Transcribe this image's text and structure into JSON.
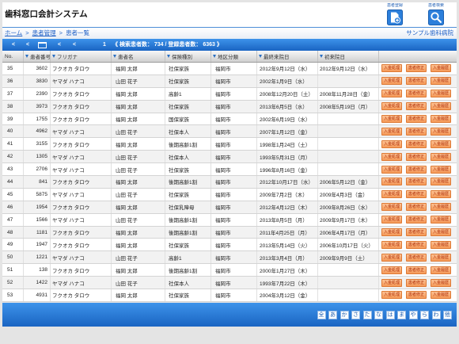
{
  "app": {
    "title": "歯科窓口会計システム"
  },
  "header_actions": {
    "register": {
      "label": "患者登録",
      "icon": "patient-register-icon"
    },
    "search": {
      "label": "患者検索",
      "icon": "patient-search-icon"
    }
  },
  "breadcrumb": {
    "items": [
      "ホーム",
      "患者管理",
      "患者一覧"
    ],
    "separator": ">"
  },
  "clinic_name": "サンプル歯科病院",
  "pager": {
    "nav": [
      "<",
      "<",
      "<",
      "<"
    ],
    "calendar_icon": "calendar-icon",
    "page": "1",
    "summary": "《 検索患者数： 734 / 登録患者数： 6363 》"
  },
  "table": {
    "columns": [
      "No.",
      "患者番号",
      "フリガナ",
      "患者名",
      "保険種別",
      "地区分類",
      "最終来院日",
      "初来院日"
    ],
    "sort_icon": "sort-icon",
    "row_actions": [
      "入金処理",
      "患者修正",
      "入金履歴"
    ],
    "rows": [
      {
        "no": "35",
        "patient_id": "3602",
        "kana": "フクオカ タロウ",
        "name": "福岡 太郎",
        "insurance": "社保家族",
        "district": "福岡市",
        "last_visit": "2012年9月12日（水）",
        "first_visit": "2012年9月12日（水）"
      },
      {
        "no": "36",
        "patient_id": "3830",
        "kana": "ヤマダ ハナコ",
        "name": "山田 花子",
        "insurance": "社保家族",
        "district": "福岡市",
        "last_visit": "2002年1月9日（水）",
        "first_visit": ""
      },
      {
        "no": "37",
        "patient_id": "2390",
        "kana": "フクオカ タロウ",
        "name": "福岡 太郎",
        "insurance": "高齢1",
        "district": "福岡市",
        "last_visit": "2008年12月20日（土）",
        "first_visit": "2008年11月28日（金）"
      },
      {
        "no": "38",
        "patient_id": "3973",
        "kana": "フクオカ タロウ",
        "name": "福岡 太郎",
        "insurance": "社保家族",
        "district": "福岡市",
        "last_visit": "2013年6月5日（水）",
        "first_visit": "2008年5月19日（月）"
      },
      {
        "no": "39",
        "patient_id": "1755",
        "kana": "フクオカ タロウ",
        "name": "福岡 太郎",
        "insurance": "国保家族",
        "district": "福岡市",
        "last_visit": "2002年6月19日（水）",
        "first_visit": ""
      },
      {
        "no": "40",
        "patient_id": "4962",
        "kana": "ヤマダ ハナコ",
        "name": "山田 花子",
        "insurance": "社保本人",
        "district": "福岡市",
        "last_visit": "2007年1月12日（金）",
        "first_visit": ""
      },
      {
        "no": "41",
        "patient_id": "3155",
        "kana": "フクオカ タロウ",
        "name": "福岡 太郎",
        "insurance": "後期高齢1割",
        "district": "福岡市",
        "last_visit": "1998年1月24日（土）",
        "first_visit": ""
      },
      {
        "no": "42",
        "patient_id": "1305",
        "kana": "ヤマダ ハナコ",
        "name": "山田 花子",
        "insurance": "社保本人",
        "district": "福岡市",
        "last_visit": "1993年5月31日（月）",
        "first_visit": ""
      },
      {
        "no": "43",
        "patient_id": "2706",
        "kana": "ヤマダ ハナコ",
        "name": "山田 花子",
        "insurance": "社保家族",
        "district": "福岡市",
        "last_visit": "1996年8月16日（金）",
        "first_visit": ""
      },
      {
        "no": "44",
        "patient_id": "841",
        "kana": "フクオカ タロウ",
        "name": "福岡 太郎",
        "insurance": "後期高齢1割",
        "district": "福岡市",
        "last_visit": "2012年10月17日（水）",
        "first_visit": "2006年5月12日（金）"
      },
      {
        "no": "45",
        "patient_id": "5875",
        "kana": "ヤマダ ハナコ",
        "name": "山田 花子",
        "insurance": "社保家族",
        "district": "福岡市",
        "last_visit": "2009年7月2日（木）",
        "first_visit": "2009年4月3日（金）"
      },
      {
        "no": "46",
        "patient_id": "1954",
        "kana": "フクオカ タロウ",
        "name": "福岡 太郎",
        "insurance": "社保乳障母",
        "district": "福岡市",
        "last_visit": "2012年4月12日（木）",
        "first_visit": "2009年8月26日（水）"
      },
      {
        "no": "47",
        "patient_id": "1566",
        "kana": "ヤマダ ハナコ",
        "name": "山田 花子",
        "insurance": "後期高齢1割",
        "district": "福岡市",
        "last_visit": "2013年8月5日（月）",
        "first_visit": "2009年9月17日（木）"
      },
      {
        "no": "48",
        "patient_id": "1181",
        "kana": "フクオカ タロウ",
        "name": "福岡 太郎",
        "insurance": "後期高齢1割",
        "district": "福岡市",
        "last_visit": "2011年4月25日（月）",
        "first_visit": "2006年4月17日（月）"
      },
      {
        "no": "49",
        "patient_id": "1947",
        "kana": "フクオカ タロウ",
        "name": "福岡 太郎",
        "insurance": "社保家族",
        "district": "福岡市",
        "last_visit": "2013年5月14日（火）",
        "first_visit": "2006年10月17日（火）"
      },
      {
        "no": "50",
        "patient_id": "1221",
        "kana": "ヤマダ ハナコ",
        "name": "山田 花子",
        "insurance": "高齢1",
        "district": "福岡市",
        "last_visit": "2013年3月4日（月）",
        "first_visit": "2009年9月9日（土）"
      },
      {
        "no": "51",
        "patient_id": "138",
        "kana": "フクオカ タロウ",
        "name": "福岡 太郎",
        "insurance": "後期高齢1割",
        "district": "福岡市",
        "last_visit": "2000年1月27日（木）",
        "first_visit": ""
      },
      {
        "no": "52",
        "patient_id": "1422",
        "kana": "ヤマダ ハナコ",
        "name": "山田 花子",
        "insurance": "社保本人",
        "district": "福岡市",
        "last_visit": "1993年7月22日（木）",
        "first_visit": ""
      },
      {
        "no": "53",
        "patient_id": "4931",
        "kana": "フクオカ タロウ",
        "name": "福岡 太郎",
        "insurance": "社保家族",
        "district": "福岡市",
        "last_visit": "2004年3月12日（金）",
        "first_visit": ""
      }
    ]
  },
  "kana_index": [
    "全",
    "あ",
    "か",
    "さ",
    "た",
    "な",
    "は",
    "ま",
    "や",
    "ら",
    "わ",
    "他"
  ],
  "colors": {
    "accent_blue": "#1f6fcf",
    "link": "#2262c6",
    "action_button": "#f7a566",
    "action_button_text": "#b0300a",
    "kana_button_text": "#1c5db0"
  }
}
